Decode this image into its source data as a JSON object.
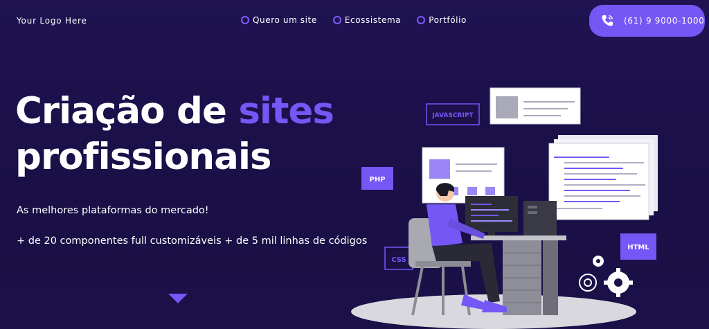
{
  "nav": {
    "logo": "Your Logo Here",
    "links": [
      "Quero um site",
      "Ecossistema",
      "Portfólio"
    ],
    "phone": "(61) 9 9000-1000"
  },
  "hero": {
    "title_line1_part1": "Criação de ",
    "title_line1_accent": "sites",
    "title_line2": "profissionais",
    "subtitle": "As melhores plataformas do mercado!",
    "features": "+ de 20 componentes full customizáveis + de 5 mil linhas de códigos"
  },
  "illustration": {
    "tags": [
      "JAVASCRIPT",
      "PHP",
      "CSS",
      "HTML"
    ]
  },
  "colors": {
    "background": "#1f1352",
    "accent": "#7457f5",
    "text": "#ffffff"
  },
  "icons": [
    "ring-icon",
    "phone-icon",
    "chevron-down-icon",
    "gear-icon"
  ]
}
